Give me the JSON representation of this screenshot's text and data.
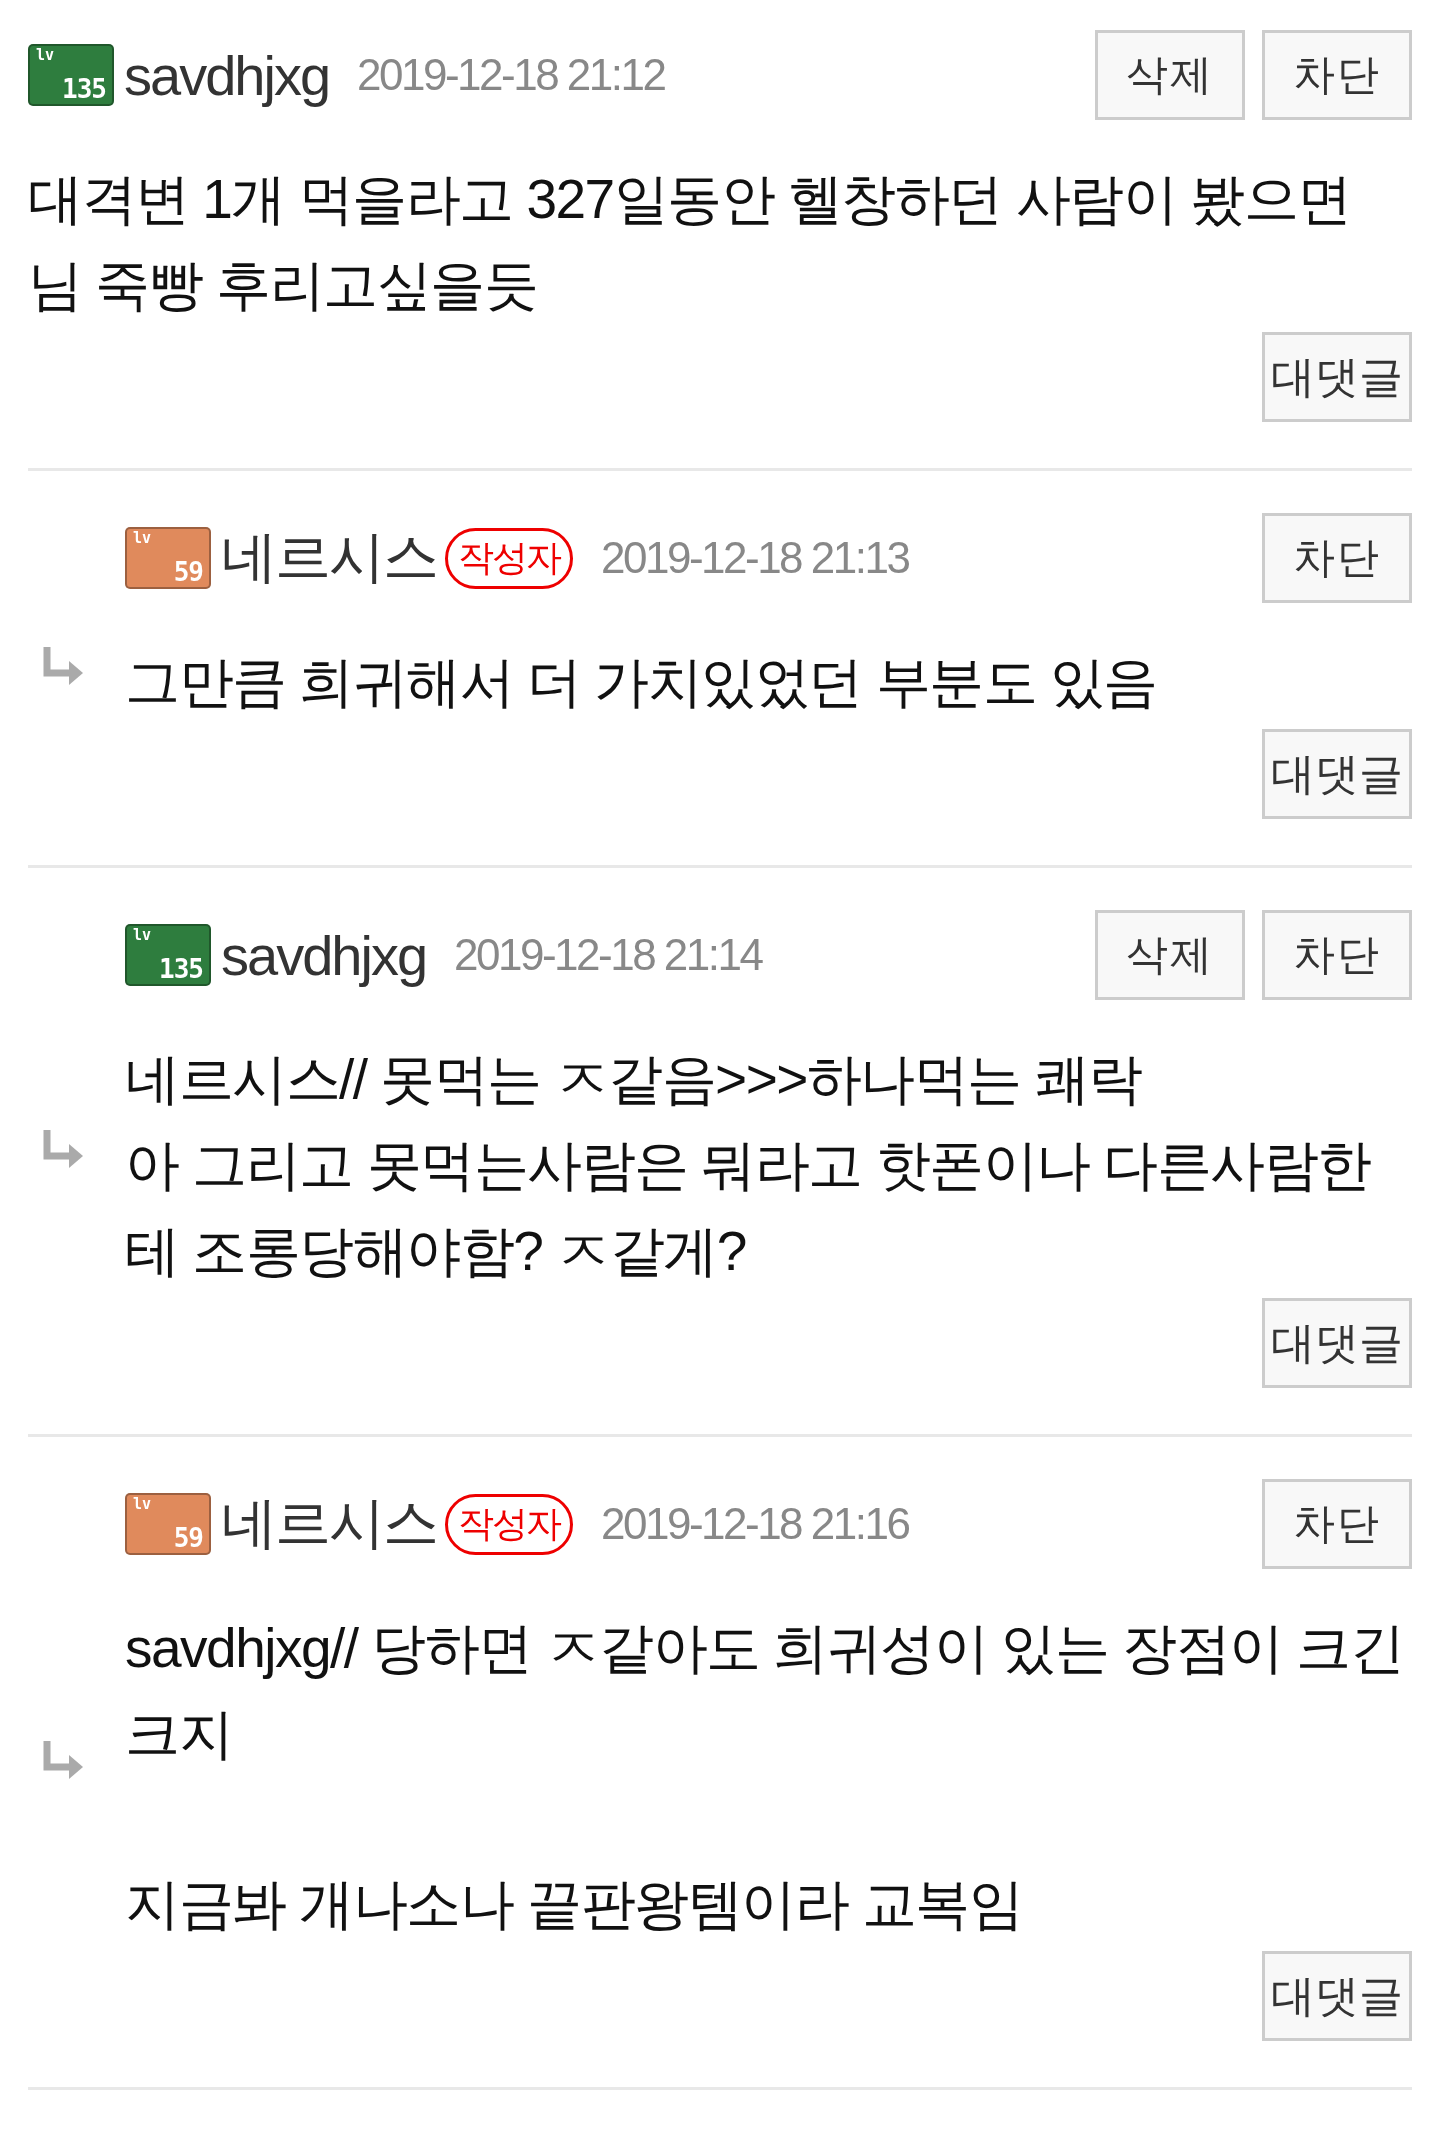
{
  "comments": [
    {
      "reply": false,
      "badge": {
        "color": "#2e7d3e",
        "prefix": "lv",
        "number": "135"
      },
      "author": "savdhjxg",
      "date": "2019-12-18 21:12",
      "actions": [
        "삭제",
        "차단"
      ],
      "paragraphs": [
        [
          "대격변 1개 먹을라고 327일동안 헬창하던 사람이 봤으면 님 죽빵 후리고싶을듯"
        ]
      ],
      "reply_button": "대댓글"
    },
    {
      "reply": true,
      "badge": {
        "color": "#e08a5c",
        "prefix": "lv",
        "number": "59"
      },
      "author": "네르시스",
      "op_tag": "작성자",
      "date": "2019-12-18 21:13",
      "actions": [
        "차단"
      ],
      "paragraphs": [
        [
          "그만큼 희귀해서 더 가치있었던 부분도 있음"
        ]
      ],
      "reply_button": "대댓글"
    },
    {
      "reply": true,
      "badge": {
        "color": "#2e7d3e",
        "prefix": "lv",
        "number": "135"
      },
      "author": "savdhjxg",
      "date": "2019-12-18 21:14",
      "actions": [
        "삭제",
        "차단"
      ],
      "paragraphs": [
        [
          "네르시스// 못먹는 ㅈ같음>>>하나먹는 쾌락",
          "아 그리고 못먹는사람은 뭐라고 핫폰이나 다른사람한테 조롱당해야함? ㅈ같게?"
        ]
      ],
      "reply_button": "대댓글"
    },
    {
      "reply": true,
      "badge": {
        "color": "#e08a5c",
        "prefix": "lv",
        "number": "59"
      },
      "author": "네르시스",
      "op_tag": "작성자",
      "date": "2019-12-18 21:16",
      "actions": [
        "차단"
      ],
      "paragraphs": [
        [
          "savdhjxg// 당하면 ㅈ같아도 희귀성이 있는 장점이 크긴크지"
        ],
        [
          "지금봐 개나소나 끝판왕템이라 교복임"
        ]
      ],
      "reply_button": "대댓글"
    }
  ]
}
